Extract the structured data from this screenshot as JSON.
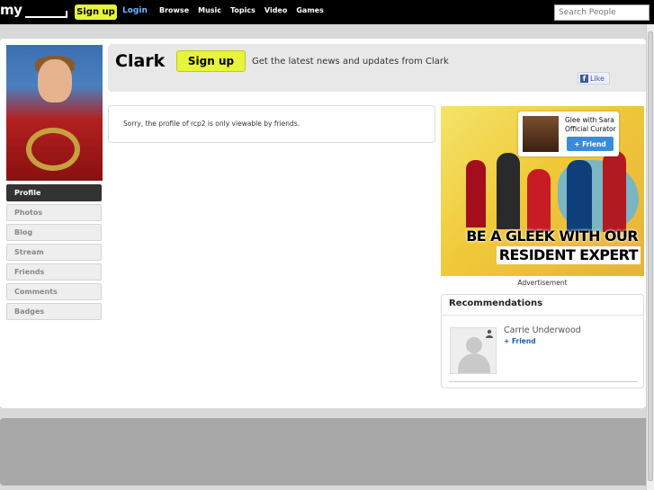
{
  "topbar": {
    "logo": "my",
    "signup": "Sign up",
    "login": "Login",
    "nav": [
      "Browse",
      "Music",
      "Topics",
      "Video",
      "Games"
    ],
    "search_placeholder": "Search People"
  },
  "sidebar": {
    "items": [
      {
        "label": "Profile",
        "active": true
      },
      {
        "label": "Photos"
      },
      {
        "label": "Blog"
      },
      {
        "label": "Stream"
      },
      {
        "label": "Friends"
      },
      {
        "label": "Comments"
      },
      {
        "label": "Badges"
      }
    ]
  },
  "header": {
    "name": "Clark",
    "signup": "Sign up",
    "description": "Get the latest news and updates from Clark",
    "like": "Like"
  },
  "notice": "Sorry, the profile of rcp2 is only viewable by friends.",
  "ad": {
    "card_title": "Glee with Sara Official Curator",
    "card_button": "+ Friend",
    "slogan_line1": "BE A GLEEK WITH OUR",
    "slogan_line2": "RESIDENT EXPERT",
    "label": "Advertisement"
  },
  "recommendations": {
    "title": "Recommendations",
    "items": [
      {
        "name": "Carrie Underwood",
        "action": "+ Friend"
      }
    ]
  }
}
